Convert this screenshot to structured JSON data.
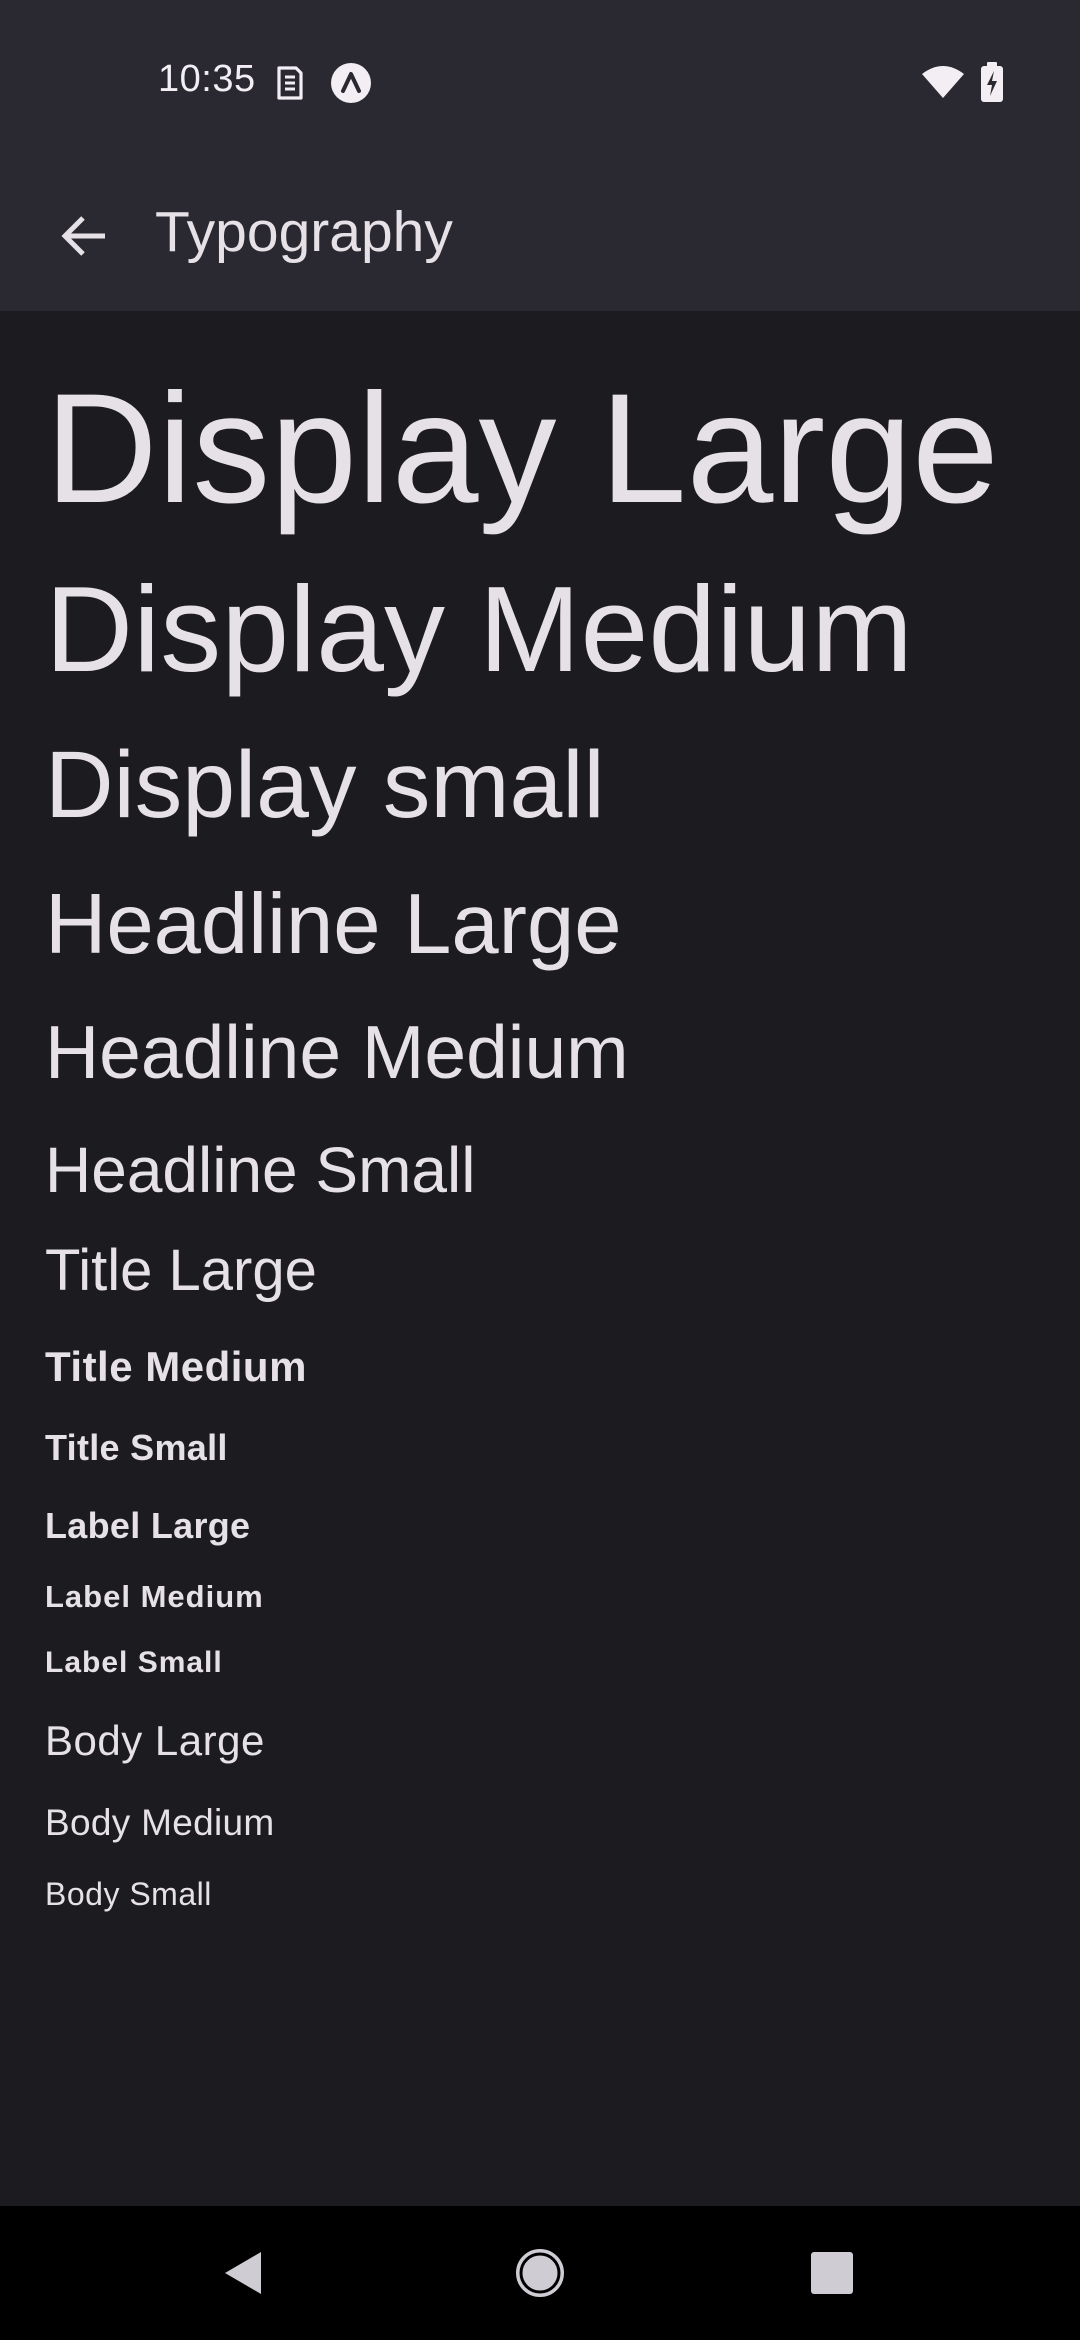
{
  "status_bar": {
    "time": "10:35",
    "left_icons": [
      "sim-card-icon",
      "app-notification-icon"
    ],
    "right_icons": [
      "wifi-icon",
      "battery-charging-icon"
    ]
  },
  "app_bar": {
    "back_icon": "arrow-back-icon",
    "title": "Typography"
  },
  "typography_samples": [
    {
      "id": "display-large",
      "label": "Display Large"
    },
    {
      "id": "display-medium",
      "label": "Display Medium"
    },
    {
      "id": "display-small",
      "label": "Display small"
    },
    {
      "id": "headline-large",
      "label": "Headline Large"
    },
    {
      "id": "headline-medium",
      "label": "Headline Medium"
    },
    {
      "id": "headline-small",
      "label": "Headline Small"
    },
    {
      "id": "title-large",
      "label": "Title Large"
    },
    {
      "id": "title-medium",
      "label": "Title Medium"
    },
    {
      "id": "title-small",
      "label": "Title Small"
    },
    {
      "id": "label-large",
      "label": "Label Large"
    },
    {
      "id": "label-medium",
      "label": "Label Medium"
    },
    {
      "id": "label-small",
      "label": "Label Small"
    },
    {
      "id": "body-large",
      "label": "Body Large"
    },
    {
      "id": "body-medium",
      "label": "Body Medium"
    },
    {
      "id": "body-small",
      "label": "Body Small"
    }
  ],
  "nav_bar": {
    "buttons": [
      "back-triangle-icon",
      "home-circle-icon",
      "recents-square-icon"
    ]
  },
  "colors": {
    "app_bar_bg": "#2a2931",
    "content_bg": "#1c1b20",
    "text": "#e6e1e6",
    "nav_bar_bg": "#000000"
  }
}
